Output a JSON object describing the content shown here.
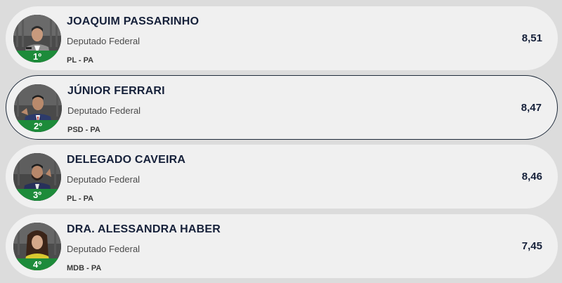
{
  "colors": {
    "page_bg": "#dcdcdc",
    "card_bg": "#f0f0f0",
    "badge_green": "#1d8b3a",
    "name_color": "#16213a",
    "highlight_border": "#1e2a3a"
  },
  "ranking": [
    {
      "rank": "1º",
      "name": "JOAQUIM PASSARINHO",
      "role": "Deputado Federal",
      "party": "PL - PA",
      "score": "8,51",
      "photo_icon": "politician-photo",
      "highlighted": false
    },
    {
      "rank": "2º",
      "name": "JÚNIOR FERRARI",
      "role": "Deputado Federal",
      "party": "PSD - PA",
      "score": "8,47",
      "photo_icon": "politician-photo",
      "highlighted": true
    },
    {
      "rank": "3º",
      "name": "DELEGADO CAVEIRA",
      "role": "Deputado Federal",
      "party": "PL - PA",
      "score": "8,46",
      "photo_icon": "politician-photo",
      "highlighted": false
    },
    {
      "rank": "4º",
      "name": "DRA. ALESSANDRA HABER",
      "role": "Deputado Federal",
      "party": "MDB - PA",
      "score": "7,45",
      "photo_icon": "politician-photo",
      "highlighted": false
    }
  ]
}
